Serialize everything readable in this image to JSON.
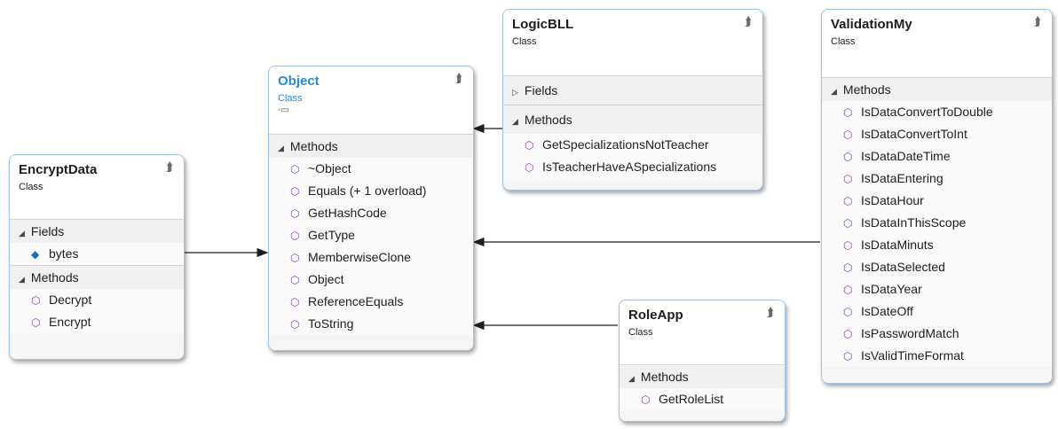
{
  "classes": {
    "encrypt": {
      "name": "EncryptData",
      "kind": "Class",
      "fields_label": "Fields",
      "fields": [
        "bytes"
      ],
      "methods_label": "Methods",
      "methods": [
        "Decrypt",
        "Encrypt"
      ]
    },
    "object": {
      "name": "Object",
      "kind": "Class",
      "methods_label": "Methods",
      "methods": [
        "~Object",
        "Equals (+ 1 overload)",
        "GetHashCode",
        "GetType",
        "MemberwiseClone",
        "Object",
        "ReferenceEquals",
        "ToString"
      ]
    },
    "logic": {
      "name": "LogicBLL",
      "kind": "Class",
      "fields_label": "Fields",
      "methods_label": "Methods",
      "methods": [
        "GetSpecializationsNotTeacher",
        "IsTeacherHaveASpecializations"
      ]
    },
    "role": {
      "name": "RoleApp",
      "kind": "Class",
      "methods_label": "Methods",
      "methods": [
        "GetRoleList"
      ]
    },
    "validation": {
      "name": "ValidationMy",
      "kind": "Class",
      "methods_label": "Methods",
      "methods": [
        "IsDataConvertToDouble",
        "IsDataConvertToInt",
        "IsDataDateTime",
        "IsDataEntering",
        "IsDataHour",
        "IsDataInThisScope",
        "IsDataMinuts",
        "IsDataSelected",
        "IsDataYear",
        "IsDateOff",
        "IsPasswordMatch",
        "IsValidTimeFormat"
      ]
    }
  },
  "icons": {
    "collapse": "double-chevron-up-icon",
    "expanded": "triangle-down-icon",
    "collapsed": "triangle-right-icon",
    "method": "method-cube-icon",
    "protected_method": "protected-method-icon",
    "private_method": "private-method-icon",
    "field": "private-field-icon",
    "interface": "lollipop-icon"
  },
  "colors": {
    "border": "#9fc3e6",
    "selected_title": "#2b8ad8",
    "method_icon": "#8a3fc0",
    "arrow": "#1e1e1e"
  }
}
